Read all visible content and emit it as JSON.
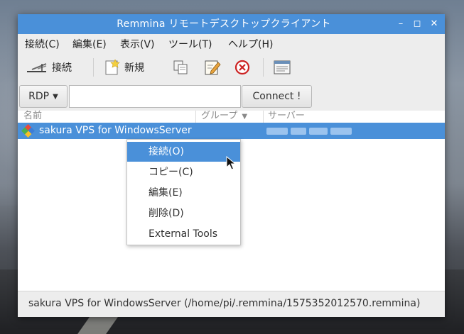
{
  "window": {
    "title": "Remmina リモートデスクトップクライアント"
  },
  "window_controls": {
    "minimize": "–",
    "maximize": "◻",
    "close": "✕"
  },
  "menubar": {
    "items": [
      "接続(C)",
      "編集(E)",
      "表示(V)",
      "ツール(T)",
      "ヘルプ(H)"
    ]
  },
  "toolbar": {
    "connect_label": "接続",
    "new_label": "新規"
  },
  "quickconnect": {
    "protocol": "RDP",
    "input_value": "",
    "connect_label": "Connect !"
  },
  "list": {
    "columns": [
      "名前",
      "グループ",
      "サーバー"
    ],
    "rows": [
      {
        "name": "sakura VPS for WindowsServer",
        "group": "",
        "server": ""
      }
    ]
  },
  "context_menu": {
    "items": [
      "接続(O)",
      "コピー(C)",
      "編集(E)",
      "削除(D)",
      "External Tools"
    ]
  },
  "status": {
    "text": "sakura VPS for WindowsServer (/home/pi/.remmina/1575352012570.remmina)"
  },
  "colors": {
    "accent": "#4a90d9",
    "chrome": "#ededed"
  }
}
